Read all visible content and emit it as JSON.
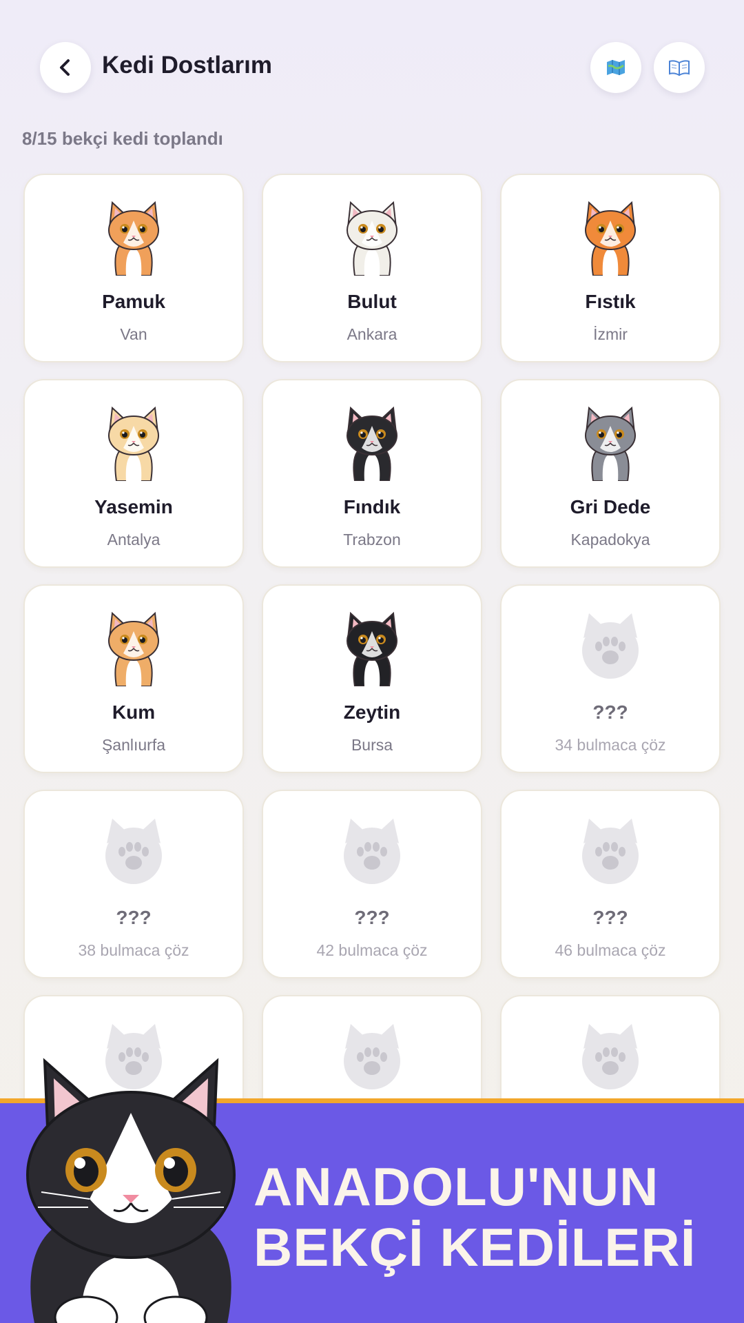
{
  "header": {
    "title": "Kedi Dostlarım",
    "back_icon": "chevron-left-icon",
    "map_icon": "map-icon",
    "book_icon": "book-icon"
  },
  "progress_text": "8/15 bekçi kedi toplandı",
  "cats": [
    {
      "name": "Pamuk",
      "city": "Van",
      "locked": false,
      "fur": "#f0a05a",
      "ear": "#ffffff"
    },
    {
      "name": "Bulut",
      "city": "Ankara",
      "locked": false,
      "fur": "#f1efe9",
      "ear": "#e8e4dc"
    },
    {
      "name": "Fıstık",
      "city": "İzmir",
      "locked": false,
      "fur": "#f08a3a",
      "ear": "#f08a3a"
    },
    {
      "name": "Yasemin",
      "city": "Antalya",
      "locked": false,
      "fur": "#f7d9a6",
      "ear": "#f7d9a6"
    },
    {
      "name": "Fındık",
      "city": "Trabzon",
      "locked": false,
      "fur": "#2a2a2e",
      "ear": "#2a2a2e"
    },
    {
      "name": "Gri Dede",
      "city": "Kapadokya",
      "locked": false,
      "fur": "#8a8d96",
      "ear": "#8a8d96"
    },
    {
      "name": "Kum",
      "city": "Şanlıurfa",
      "locked": false,
      "fur": "#efad68",
      "ear": "#efad68"
    },
    {
      "name": "Zeytin",
      "city": "Bursa",
      "locked": false,
      "fur": "#222226",
      "ear": "#222226"
    },
    {
      "name": "???",
      "city": "34 bulmaca çöz",
      "locked": true
    },
    {
      "name": "???",
      "city": "38 bulmaca çöz",
      "locked": true
    },
    {
      "name": "???",
      "city": "42 bulmaca çöz",
      "locked": true
    },
    {
      "name": "???",
      "city": "46 bulmaca çöz",
      "locked": true
    },
    {
      "name": "",
      "city": "",
      "locked": true
    },
    {
      "name": "",
      "city": "",
      "locked": true
    },
    {
      "name": "",
      "city": "",
      "locked": true
    }
  ],
  "banner": {
    "line1": "ANADOLU'NUN",
    "line2": "BEKÇİ KEDİLERİ",
    "bg": "#6b59e6",
    "accent": "#f2a72c"
  }
}
